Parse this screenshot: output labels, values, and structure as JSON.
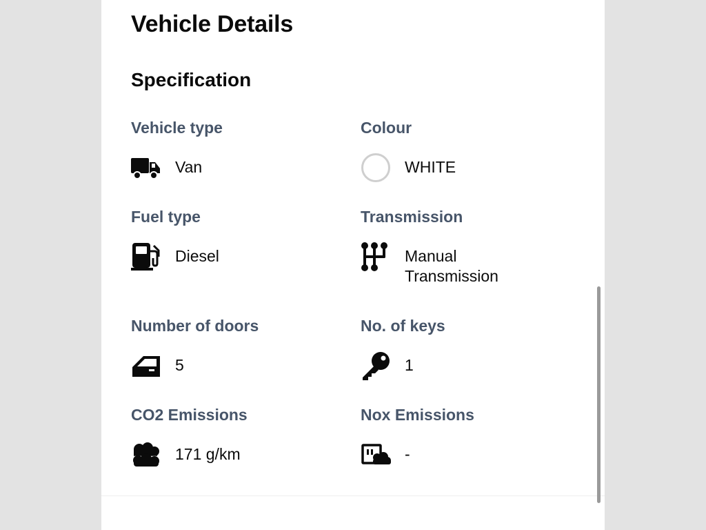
{
  "page": {
    "title": "Vehicle Details",
    "section_title": "Specification"
  },
  "specs": [
    {
      "label": "Vehicle type",
      "value": "Van",
      "icon": "van-icon"
    },
    {
      "label": "Colour",
      "value": "WHITE",
      "icon": "colour-swatch-icon",
      "swatch_color": "#ffffff"
    },
    {
      "label": "Fuel type",
      "value": "Diesel",
      "icon": "fuel-pump-icon"
    },
    {
      "label": "Transmission",
      "value": "Manual Transmission",
      "icon": "gear-shift-icon"
    },
    {
      "label": "Number of doors",
      "value": "5",
      "icon": "car-door-icon"
    },
    {
      "label": "No. of keys",
      "value": "1",
      "icon": "key-icon"
    },
    {
      "label": "CO2 Emissions",
      "value": "171 g/km",
      "icon": "cloud-icon"
    },
    {
      "label": "Nox Emissions",
      "value": "-",
      "icon": "emissions-icon"
    }
  ],
  "colors": {
    "label": "#475569",
    "text": "#0b0b0b",
    "background": "#e3e3e3",
    "panel": "#ffffff"
  }
}
